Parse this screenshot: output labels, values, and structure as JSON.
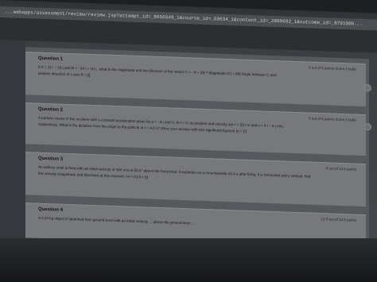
{
  "browser": {
    "url": "...webapps/assessment/review/review.jsp?attempt_id=_8656549_1&course_id=_50634_1&content_id=_2899692_1&outcome_id=_8791006..."
  },
  "questions": [
    {
      "title": "Question 1",
      "points": "0 out of 5 points (Extra Credit)",
      "line1": "If A = 12 i − 16 j and B = −24 i + 10 j , what is the magnitude and the direction of the vector C = −A + 3B ? Magnitude |C| = [M]  Angle between C and",
      "line2": "positive direction of x axis θ = [t]"
    },
    {
      "title": "Question 2",
      "points": "0 out of 5 points (Extra Credit)",
      "line1": "A particle moves in the xy plane with a constant acceleration given by a = −4 j m/s^2. At t = 0, its position and velocity are r = 20 i m and v = 4 i − 6 j m/s,",
      "line2": "respectively. What is the distance from the origin to the particle at t = 4.0 s? (Give your answer with two significant figures) |r| = [r]"
    },
    {
      "title": "Question 3",
      "points": "0 out of 12.5 points",
      "line1": "An artillery shell is fired with an initial velocity of 300 m/s at 55.0° above the horizontal. It explodes on a mountainside 42.0 s after firing. It is horizontal and y vertical, find",
      "line2": "the velocity (magnitude and direction) at this moment. |v| = [v]  θ = [t]"
    },
    {
      "title": "Question 4",
      "points": "12.5 out of 12.5 points",
      "line1": "A 0.20 kg object is launched from ground level with an initial velocity ... above the ground level ...",
      "line2": ""
    }
  ]
}
